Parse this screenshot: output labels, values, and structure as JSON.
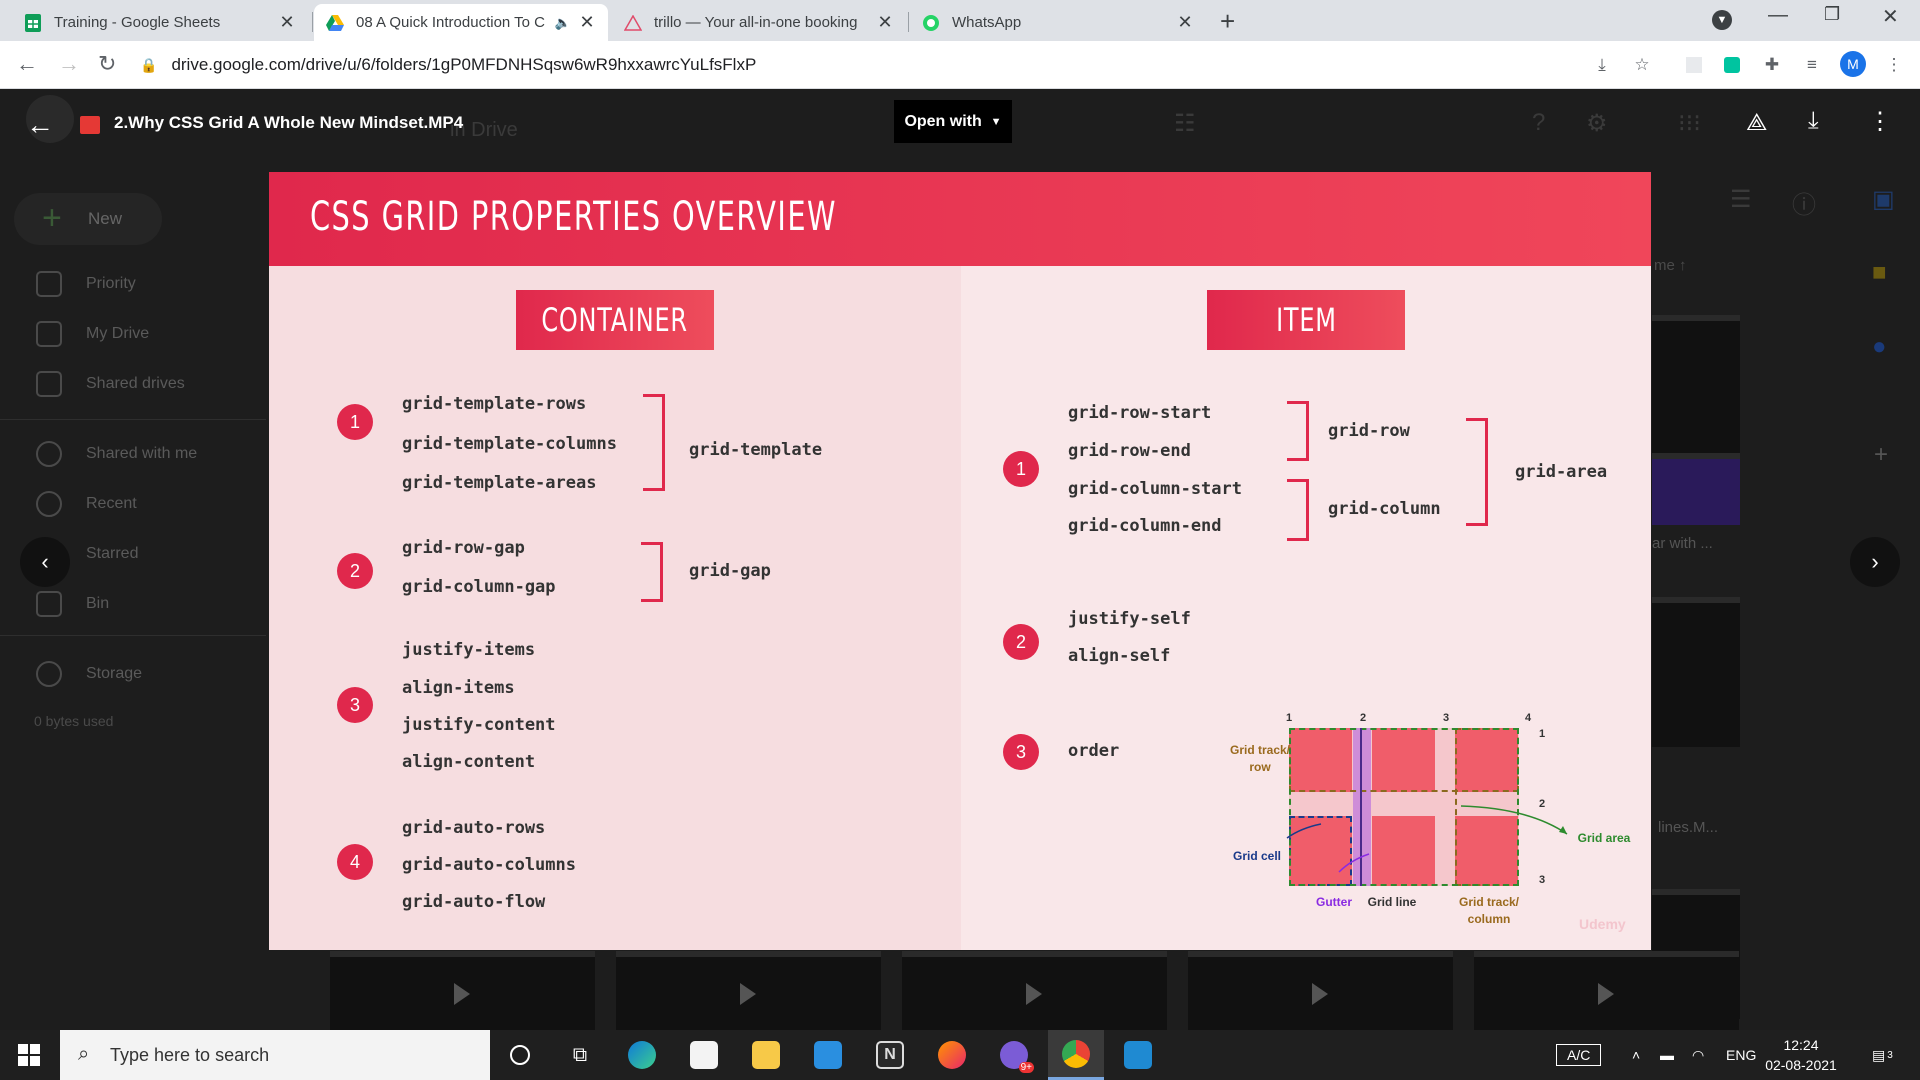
{
  "browser": {
    "tabs": [
      {
        "title": "Training - Google Sheets",
        "icon": "sheets-icon",
        "color": "#0f9d58"
      },
      {
        "title": "08 A Quick Introduction To C",
        "icon": "drive-icon",
        "color": "#1a73e8"
      },
      {
        "title": "trillo — Your all-in-one booking",
        "icon": "trillo-icon",
        "color": "#e04b6a"
      },
      {
        "title": "WhatsApp",
        "icon": "whatsapp-icon",
        "color": "#25d366"
      }
    ],
    "url": "drive.google.com/drive/u/6/folders/1gP0MFDNHSqsw6wR9hxxawrcYuLfsFlxP",
    "profile_initial": "M"
  },
  "drive_bg": {
    "new_label": "New",
    "sidebar": [
      "Priority",
      "My Drive",
      "Shared drives",
      "Shared with me",
      "Recent",
      "Starred",
      "Bin",
      "Storage"
    ],
    "storage_text": "0 bytes used",
    "header_fragment": "in Drive",
    "sort_label": "me",
    "thumb_captions": [
      "ar with ...",
      "lines.M..."
    ]
  },
  "viewer": {
    "file_name": "2.Why CSS Grid A Whole New Mindset.MP4",
    "open_with": "Open with"
  },
  "slide": {
    "title": "CSS GRID PROPERTIES OVERVIEW",
    "container": {
      "heading": "CONTAINER",
      "groups": [
        {
          "num": "1",
          "props": [
            "grid-template-rows",
            "grid-template-columns",
            "grid-template-areas"
          ],
          "shorthand": "grid-template"
        },
        {
          "num": "2",
          "props": [
            "grid-row-gap",
            "grid-column-gap"
          ],
          "shorthand": "grid-gap"
        },
        {
          "num": "3",
          "props": [
            "justify-items",
            "align-items",
            "justify-content",
            "align-content"
          ]
        },
        {
          "num": "4",
          "props": [
            "grid-auto-rows",
            "grid-auto-columns",
            "grid-auto-flow"
          ]
        }
      ]
    },
    "item": {
      "heading": "ITEM",
      "groups": [
        {
          "num": "1",
          "props": [
            "grid-row-start",
            "grid-row-end",
            "grid-column-start",
            "grid-column-end"
          ],
          "sub": [
            "grid-row",
            "grid-column"
          ],
          "shorthand": "grid-area"
        },
        {
          "num": "2",
          "props": [
            "justify-self",
            "align-self"
          ]
        },
        {
          "num": "3",
          "props": [
            "order"
          ]
        }
      ]
    },
    "diagram": {
      "col_numbers": [
        "1",
        "2",
        "3",
        "4"
      ],
      "row_numbers": [
        "1",
        "2",
        "3"
      ],
      "labels": {
        "track_row": "Grid track/\nrow",
        "cell": "Grid cell",
        "gutter": "Gutter",
        "line": "Grid line",
        "track_col": "Grid track/\ncolumn",
        "area": "Grid area"
      },
      "colors": {
        "cell": "#f05d6a",
        "track_label": "#9a6a1e",
        "cell_label": "#1a3a8a",
        "gutter_label": "#8a2be2",
        "area_label": "#2e8b2e"
      }
    },
    "watermark": "Udemy"
  },
  "taskbar": {
    "search_placeholder": "Type here to search",
    "keyboard_box": "A/C",
    "lang": "ENG",
    "time": "12:24",
    "date": "02-08-2021",
    "notif_count": "3",
    "chrome_badge": "9+"
  }
}
